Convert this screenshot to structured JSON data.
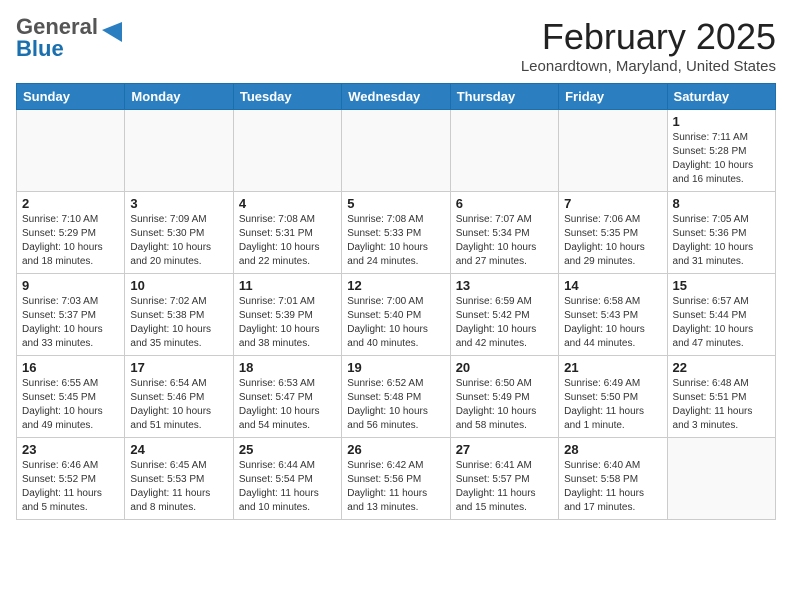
{
  "header": {
    "logo_general": "General",
    "logo_blue": "Blue",
    "month_title": "February 2025",
    "location": "Leonardtown, Maryland, United States"
  },
  "weekdays": [
    "Sunday",
    "Monday",
    "Tuesday",
    "Wednesday",
    "Thursday",
    "Friday",
    "Saturday"
  ],
  "weeks": [
    [
      {
        "day": "",
        "info": ""
      },
      {
        "day": "",
        "info": ""
      },
      {
        "day": "",
        "info": ""
      },
      {
        "day": "",
        "info": ""
      },
      {
        "day": "",
        "info": ""
      },
      {
        "day": "",
        "info": ""
      },
      {
        "day": "1",
        "info": "Sunrise: 7:11 AM\nSunset: 5:28 PM\nDaylight: 10 hours\nand 16 minutes."
      }
    ],
    [
      {
        "day": "2",
        "info": "Sunrise: 7:10 AM\nSunset: 5:29 PM\nDaylight: 10 hours\nand 18 minutes."
      },
      {
        "day": "3",
        "info": "Sunrise: 7:09 AM\nSunset: 5:30 PM\nDaylight: 10 hours\nand 20 minutes."
      },
      {
        "day": "4",
        "info": "Sunrise: 7:08 AM\nSunset: 5:31 PM\nDaylight: 10 hours\nand 22 minutes."
      },
      {
        "day": "5",
        "info": "Sunrise: 7:08 AM\nSunset: 5:33 PM\nDaylight: 10 hours\nand 24 minutes."
      },
      {
        "day": "6",
        "info": "Sunrise: 7:07 AM\nSunset: 5:34 PM\nDaylight: 10 hours\nand 27 minutes."
      },
      {
        "day": "7",
        "info": "Sunrise: 7:06 AM\nSunset: 5:35 PM\nDaylight: 10 hours\nand 29 minutes."
      },
      {
        "day": "8",
        "info": "Sunrise: 7:05 AM\nSunset: 5:36 PM\nDaylight: 10 hours\nand 31 minutes."
      }
    ],
    [
      {
        "day": "9",
        "info": "Sunrise: 7:03 AM\nSunset: 5:37 PM\nDaylight: 10 hours\nand 33 minutes."
      },
      {
        "day": "10",
        "info": "Sunrise: 7:02 AM\nSunset: 5:38 PM\nDaylight: 10 hours\nand 35 minutes."
      },
      {
        "day": "11",
        "info": "Sunrise: 7:01 AM\nSunset: 5:39 PM\nDaylight: 10 hours\nand 38 minutes."
      },
      {
        "day": "12",
        "info": "Sunrise: 7:00 AM\nSunset: 5:40 PM\nDaylight: 10 hours\nand 40 minutes."
      },
      {
        "day": "13",
        "info": "Sunrise: 6:59 AM\nSunset: 5:42 PM\nDaylight: 10 hours\nand 42 minutes."
      },
      {
        "day": "14",
        "info": "Sunrise: 6:58 AM\nSunset: 5:43 PM\nDaylight: 10 hours\nand 44 minutes."
      },
      {
        "day": "15",
        "info": "Sunrise: 6:57 AM\nSunset: 5:44 PM\nDaylight: 10 hours\nand 47 minutes."
      }
    ],
    [
      {
        "day": "16",
        "info": "Sunrise: 6:55 AM\nSunset: 5:45 PM\nDaylight: 10 hours\nand 49 minutes."
      },
      {
        "day": "17",
        "info": "Sunrise: 6:54 AM\nSunset: 5:46 PM\nDaylight: 10 hours\nand 51 minutes."
      },
      {
        "day": "18",
        "info": "Sunrise: 6:53 AM\nSunset: 5:47 PM\nDaylight: 10 hours\nand 54 minutes."
      },
      {
        "day": "19",
        "info": "Sunrise: 6:52 AM\nSunset: 5:48 PM\nDaylight: 10 hours\nand 56 minutes."
      },
      {
        "day": "20",
        "info": "Sunrise: 6:50 AM\nSunset: 5:49 PM\nDaylight: 10 hours\nand 58 minutes."
      },
      {
        "day": "21",
        "info": "Sunrise: 6:49 AM\nSunset: 5:50 PM\nDaylight: 11 hours\nand 1 minute."
      },
      {
        "day": "22",
        "info": "Sunrise: 6:48 AM\nSunset: 5:51 PM\nDaylight: 11 hours\nand 3 minutes."
      }
    ],
    [
      {
        "day": "23",
        "info": "Sunrise: 6:46 AM\nSunset: 5:52 PM\nDaylight: 11 hours\nand 5 minutes."
      },
      {
        "day": "24",
        "info": "Sunrise: 6:45 AM\nSunset: 5:53 PM\nDaylight: 11 hours\nand 8 minutes."
      },
      {
        "day": "25",
        "info": "Sunrise: 6:44 AM\nSunset: 5:54 PM\nDaylight: 11 hours\nand 10 minutes."
      },
      {
        "day": "26",
        "info": "Sunrise: 6:42 AM\nSunset: 5:56 PM\nDaylight: 11 hours\nand 13 minutes."
      },
      {
        "day": "27",
        "info": "Sunrise: 6:41 AM\nSunset: 5:57 PM\nDaylight: 11 hours\nand 15 minutes."
      },
      {
        "day": "28",
        "info": "Sunrise: 6:40 AM\nSunset: 5:58 PM\nDaylight: 11 hours\nand 17 minutes."
      },
      {
        "day": "",
        "info": ""
      }
    ]
  ]
}
